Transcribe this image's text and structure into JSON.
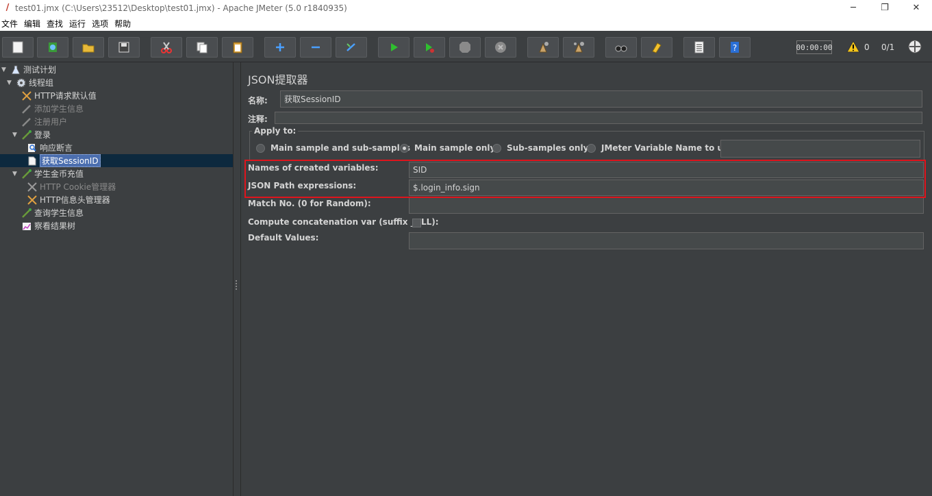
{
  "window": {
    "title": "test01.jmx (C:\\Users\\23512\\Desktop\\test01.jmx) - Apache JMeter (5.0 r1840935)",
    "minimize": "─",
    "restore": "❐",
    "close": "✕"
  },
  "menu": [
    "文件",
    "编辑",
    "查找",
    "运行",
    "选项",
    "帮助"
  ],
  "toolbar": {
    "timer": "00:00:00",
    "warnings": "0",
    "threads": "0/1"
  },
  "tree": [
    {
      "label": "测试计划",
      "icon": "test-plan-icon"
    },
    {
      "label": "线程组",
      "icon": "gear-icon"
    },
    {
      "label": "HTTP请求默认值",
      "icon": "tools-icon"
    },
    {
      "label": "添加学生信息",
      "icon": "pipette-icon"
    },
    {
      "label": "注册用户",
      "icon": "pipette-icon"
    },
    {
      "label": "登录",
      "icon": "pipette-icon"
    },
    {
      "label": "响应断言",
      "icon": "magnifier-icon"
    },
    {
      "label": "获取SessionID",
      "icon": "document-icon"
    },
    {
      "label": "学生金币充值",
      "icon": "pipette-icon"
    },
    {
      "label": "HTTP Cookie管理器",
      "icon": "tools-icon"
    },
    {
      "label": "HTTP信息头管理器",
      "icon": "tools-icon"
    },
    {
      "label": "查询学生信息",
      "icon": "pipette-icon"
    },
    {
      "label": "察看结果树",
      "icon": "chart-icon"
    }
  ],
  "panel": {
    "title": "JSON提取器",
    "name_label": "名称:",
    "name_value": "获取SessionID",
    "comment_label": "注释:",
    "comment_value": "",
    "apply_to": {
      "title": "Apply to:",
      "options": [
        "Main sample and sub-samples",
        "Main sample only",
        "Sub-samples only",
        "JMeter Variable Name to use"
      ],
      "selected": "Main sample only",
      "variable_value": ""
    },
    "variables_label": "Names of created variables:",
    "variables_value": "SID",
    "json_path_label": "JSON Path expressions:",
    "json_path_value": "$.login_info.sign",
    "match_no_label": "Match No. (0 for Random):",
    "match_no_value": "",
    "concat_label": "Compute concatenation var (suffix _ALL):",
    "concat_checked": false,
    "default_label": "Default Values:",
    "default_value": ""
  },
  "colors": {
    "highlight": "#e0141c",
    "selection": "#4b6eaf",
    "background": "#3c3f41"
  }
}
